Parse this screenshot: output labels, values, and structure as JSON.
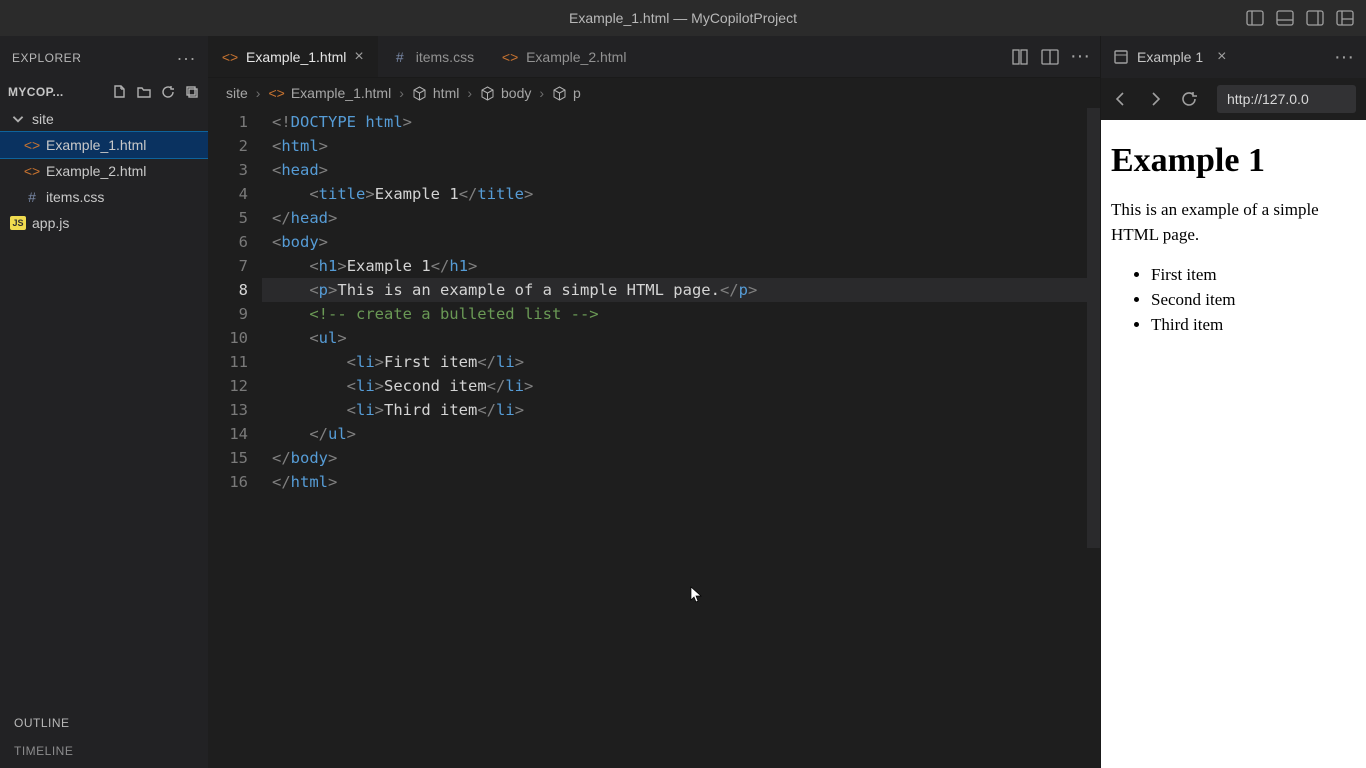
{
  "window": {
    "title": "Example_1.html — MyCopilotProject"
  },
  "sidebar": {
    "header": "EXPLORER",
    "project": "MYCOP...",
    "tree": {
      "folder": "site",
      "files": [
        {
          "name": "Example_1.html",
          "type": "html"
        },
        {
          "name": "Example_2.html",
          "type": "html"
        },
        {
          "name": "items.css",
          "type": "css"
        }
      ],
      "root_file": {
        "name": "app.js",
        "type": "js"
      }
    },
    "sections": [
      "OUTLINE",
      "TIMELINE"
    ]
  },
  "tabs": [
    {
      "label": "Example_1.html",
      "type": "html",
      "active": true,
      "closable": true
    },
    {
      "label": "items.css",
      "type": "css",
      "active": false,
      "closable": false
    },
    {
      "label": "Example_2.html",
      "type": "html",
      "active": false,
      "closable": false
    }
  ],
  "breadcrumbs": [
    {
      "label": "site",
      "icon": null
    },
    {
      "label": "Example_1.html",
      "icon": "html"
    },
    {
      "label": "html",
      "icon": "cube"
    },
    {
      "label": "body",
      "icon": "cube"
    },
    {
      "label": "p",
      "icon": "cube"
    }
  ],
  "editor": {
    "current_line": 8,
    "lines": [
      {
        "n": 1,
        "html": "<span class='tok-bracket'>&lt;!</span><span class='tok-tag'>DOCTYPE</span> <span class='tok-tag'>html</span><span class='tok-bracket'>&gt;</span>"
      },
      {
        "n": 2,
        "html": "<span class='tok-bracket'>&lt;</span><span class='tok-tag'>html</span><span class='tok-bracket'>&gt;</span>"
      },
      {
        "n": 3,
        "html": "<span class='tok-bracket'>&lt;</span><span class='tok-tag'>head</span><span class='tok-bracket'>&gt;</span>"
      },
      {
        "n": 4,
        "html": "    <span class='tok-bracket'>&lt;</span><span class='tok-tag'>title</span><span class='tok-bracket'>&gt;</span><span class='tok-text'>Example 1</span><span class='tok-bracket'>&lt;/</span><span class='tok-tag'>title</span><span class='tok-bracket'>&gt;</span>"
      },
      {
        "n": 5,
        "html": "<span class='tok-bracket'>&lt;/</span><span class='tok-tag'>head</span><span class='tok-bracket'>&gt;</span>"
      },
      {
        "n": 6,
        "html": "<span class='tok-bracket'>&lt;</span><span class='tok-tag'>body</span><span class='tok-bracket'>&gt;</span>"
      },
      {
        "n": 7,
        "html": "    <span class='tok-bracket'>&lt;</span><span class='tok-tag'>h1</span><span class='tok-bracket'>&gt;</span><span class='tok-text'>Example 1</span><span class='tok-bracket'>&lt;/</span><span class='tok-tag'>h1</span><span class='tok-bracket'>&gt;</span>"
      },
      {
        "n": 8,
        "html": "    <span class='tok-bracket'>&lt;</span><span class='tok-tag'>p</span><span class='tok-bracket'>&gt;</span><span class='tok-text'>This is an example of a simple HTML page.</span><span class='tok-bracket'>&lt;/</span><span class='tok-tag'>p</span><span class='tok-bracket'>&gt;</span>"
      },
      {
        "n": 9,
        "html": "    <span class='tok-comment'>&lt;!-- create a bulleted list --&gt;</span>"
      },
      {
        "n": 10,
        "html": "    <span class='tok-bracket'>&lt;</span><span class='tok-tag'>ul</span><span class='tok-bracket'>&gt;</span>"
      },
      {
        "n": 11,
        "html": "        <span class='tok-bracket'>&lt;</span><span class='tok-tag'>li</span><span class='tok-bracket'>&gt;</span><span class='tok-text'>First item</span><span class='tok-bracket'>&lt;/</span><span class='tok-tag'>li</span><span class='tok-bracket'>&gt;</span>"
      },
      {
        "n": 12,
        "html": "        <span class='tok-bracket'>&lt;</span><span class='tok-tag'>li</span><span class='tok-bracket'>&gt;</span><span class='tok-text'>Second item</span><span class='tok-bracket'>&lt;/</span><span class='tok-tag'>li</span><span class='tok-bracket'>&gt;</span>"
      },
      {
        "n": 13,
        "html": "        <span class='tok-bracket'>&lt;</span><span class='tok-tag'>li</span><span class='tok-bracket'>&gt;</span><span class='tok-text'>Third item</span><span class='tok-bracket'>&lt;/</span><span class='tok-tag'>li</span><span class='tok-bracket'>&gt;</span>"
      },
      {
        "n": 14,
        "html": "    <span class='tok-bracket'>&lt;/</span><span class='tok-tag'>ul</span><span class='tok-bracket'>&gt;</span>"
      },
      {
        "n": 15,
        "html": "<span class='tok-bracket'>&lt;/</span><span class='tok-tag'>body</span><span class='tok-bracket'>&gt;</span>"
      },
      {
        "n": 16,
        "html": "<span class='tok-bracket'>&lt;/</span><span class='tok-tag'>html</span><span class='tok-bracket'>&gt;</span>"
      }
    ]
  },
  "preview": {
    "tab_title": "Example 1",
    "url": "http://127.0.0",
    "heading": "Example 1",
    "paragraph": "This is an example of a simple HTML page.",
    "items": [
      "First item",
      "Second item",
      "Third item"
    ]
  }
}
